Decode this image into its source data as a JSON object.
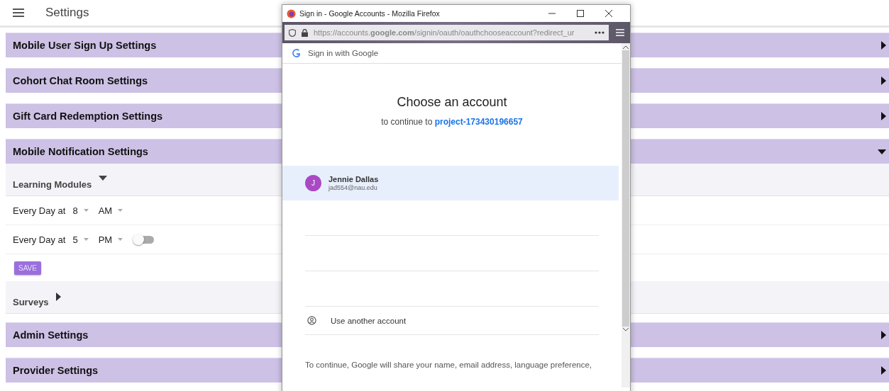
{
  "app_bar": {
    "title": "Settings"
  },
  "sections": [
    {
      "title": "Mobile User Sign Up Settings",
      "expanded": false
    },
    {
      "title": "Cohort Chat Room Settings",
      "expanded": false
    },
    {
      "title": "Gift Card Redemption Settings",
      "expanded": false
    },
    {
      "title": "Mobile Notification Settings",
      "expanded": true,
      "subsections": [
        {
          "title": "Learning Modules",
          "expanded": true,
          "schedules": [
            {
              "label": "Every Day at",
              "hour": "8",
              "period": "AM"
            },
            {
              "label": "Every Day at",
              "hour": "5",
              "period": "PM",
              "toggle": {
                "on": false
              }
            }
          ],
          "save_button": "SAVE"
        },
        {
          "title": "Surveys",
          "expanded": false
        }
      ]
    },
    {
      "title": "Admin Settings",
      "expanded": false
    },
    {
      "title": "Provider Settings",
      "expanded": false
    }
  ],
  "popup": {
    "window_title": "Sign in - Google Accounts - Mozilla Firefox",
    "url": "https://accounts.**google.com**/signin/oauth/oauthchooseaccount?redirect_ur",
    "header": "Sign in with Google",
    "heading": "Choose an account",
    "subtitle": "to continue to",
    "project_link": "project-173430196657",
    "accounts": [
      {
        "initial": "J",
        "name": "Jennie Dallas",
        "email": "jad554@nau.edu",
        "selected": true
      }
    ],
    "other_account": "Use another account",
    "footer": "To continue, Google will share your name, email address, language preference,"
  }
}
